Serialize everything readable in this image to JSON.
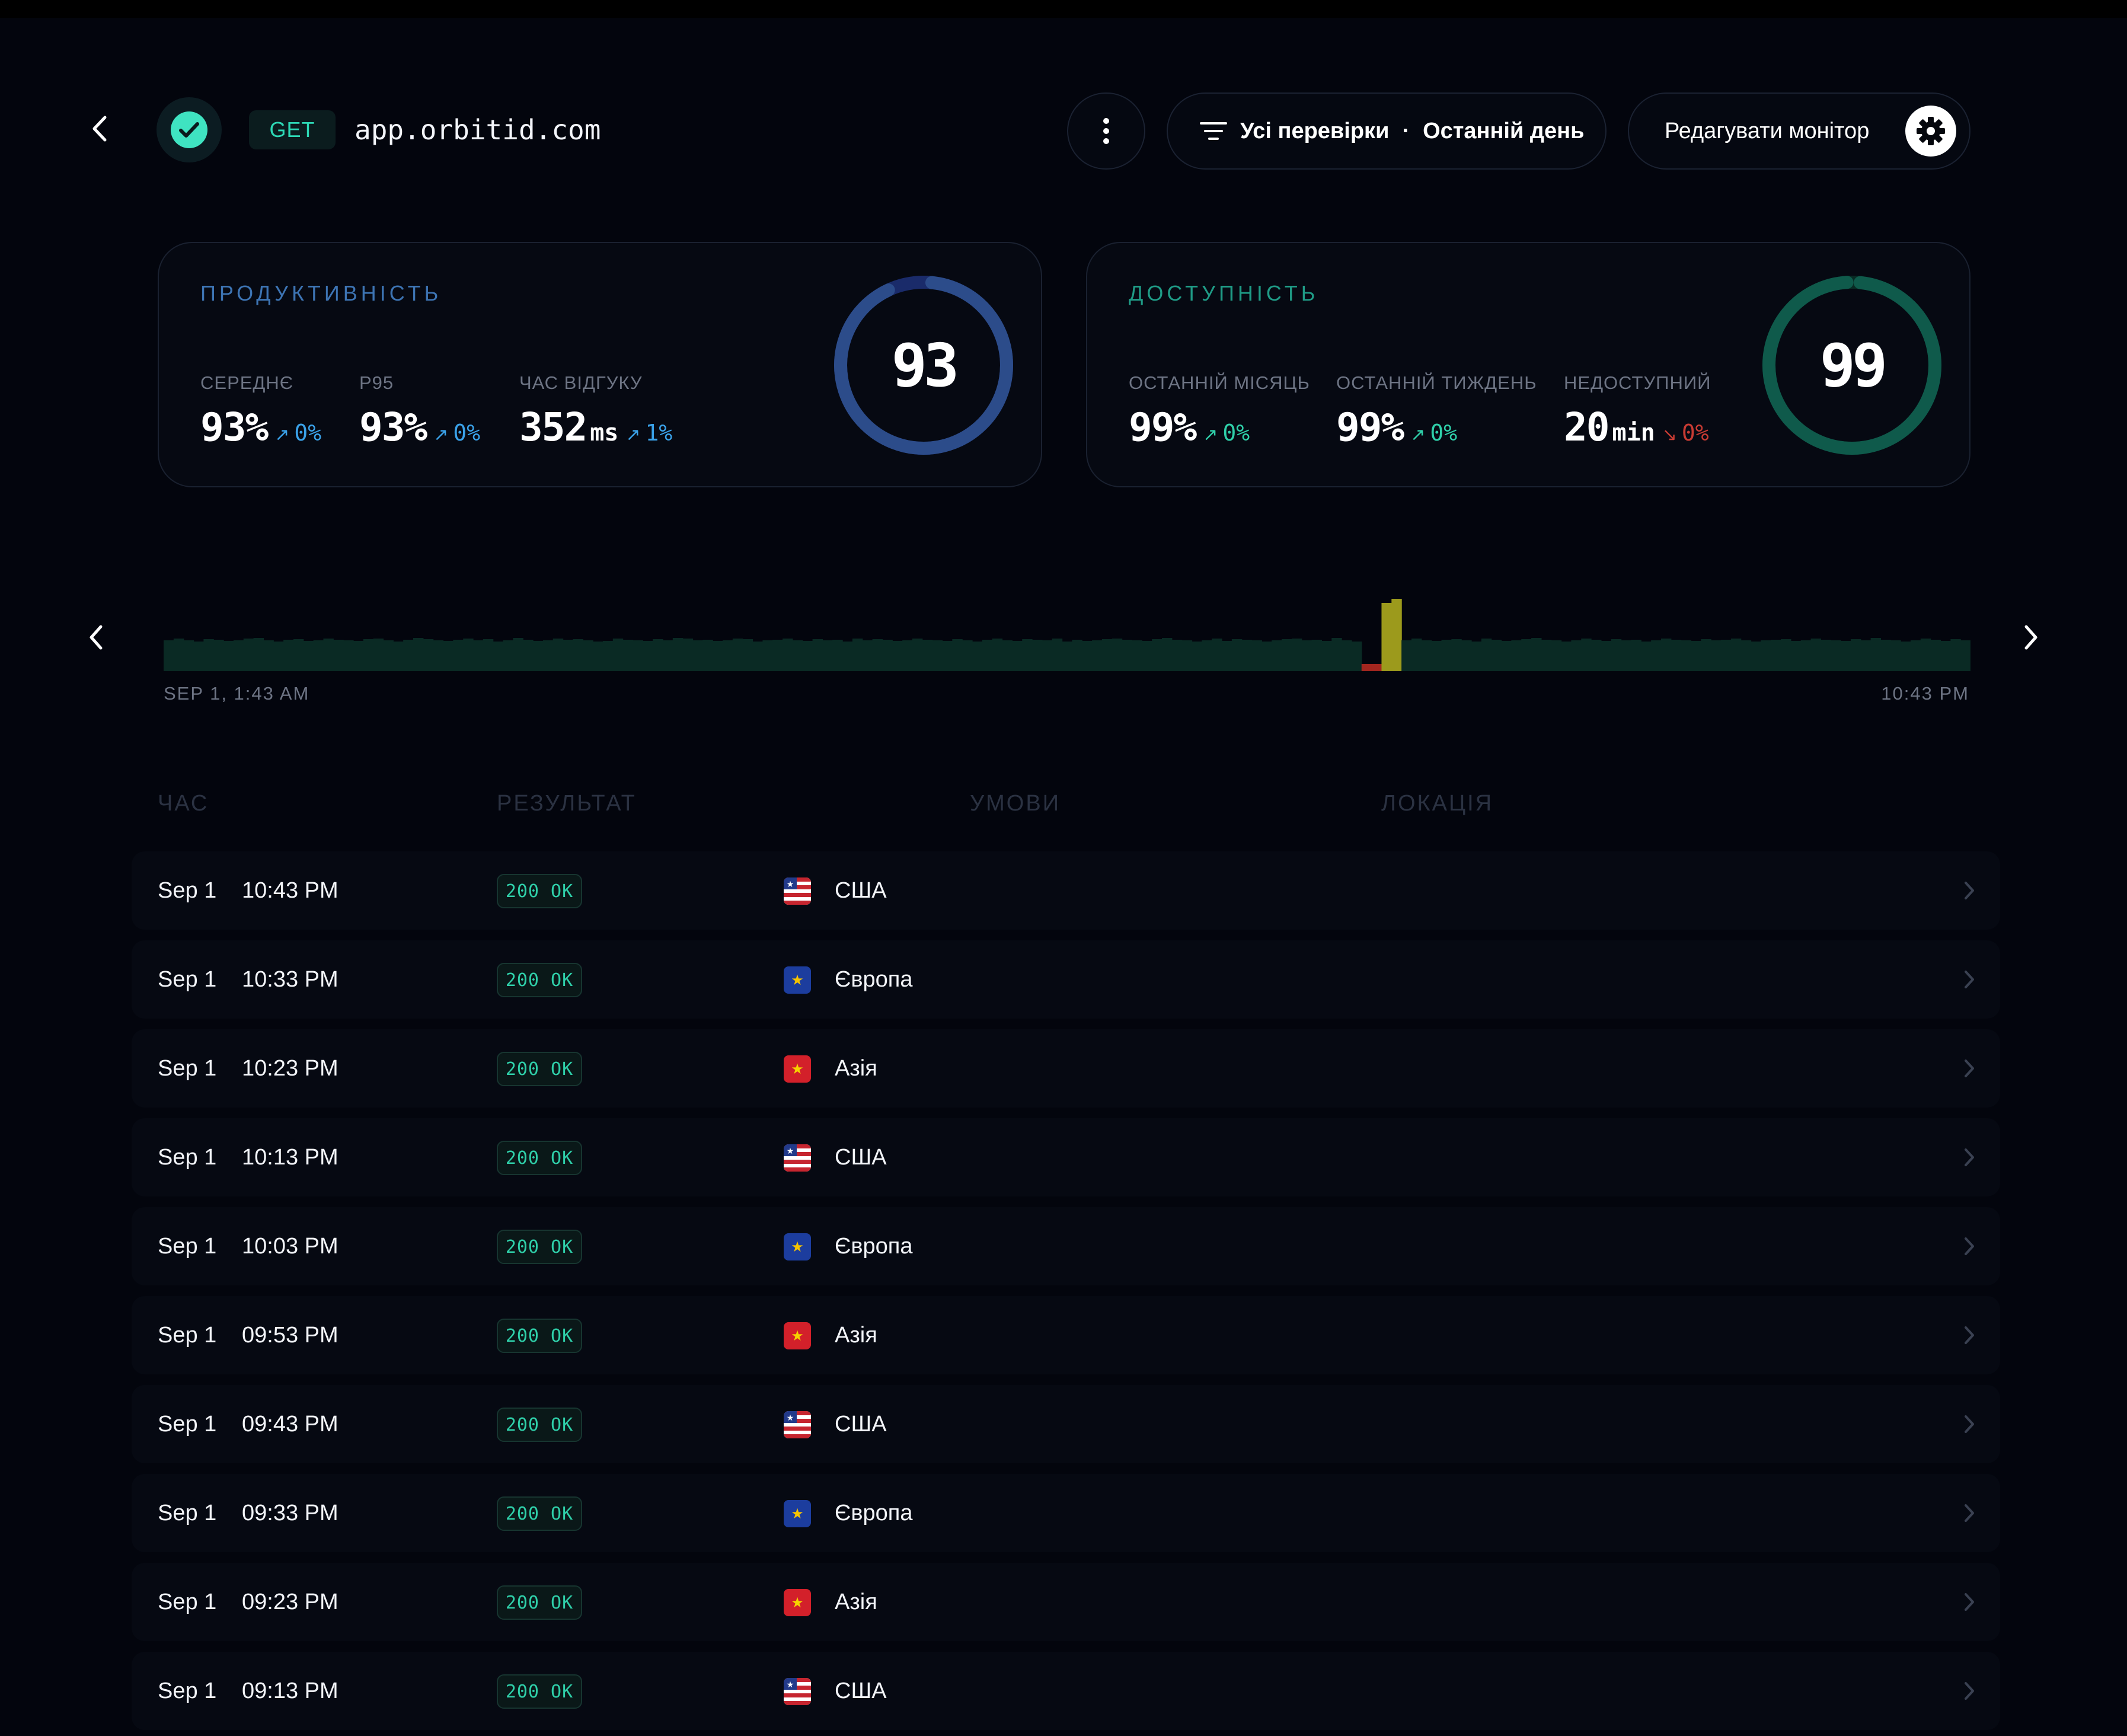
{
  "header": {
    "method": "GET",
    "host": "app.orbitid.com",
    "filter_checks": "Усі перевірки",
    "filter_separator": "·",
    "filter_period": "Останній день",
    "edit_label": "Редагувати монітор"
  },
  "performance": {
    "title": "ПРОДУКТИВНІСТЬ",
    "score": "93",
    "score_fraction": 0.93,
    "ring_color": "#2c4c8a",
    "metrics": [
      {
        "label": "Середнє",
        "value": "93%",
        "unit": "",
        "delta": "0%",
        "trend": "up"
      },
      {
        "label": "P95",
        "value": "93%",
        "unit": "",
        "delta": "0%",
        "trend": "up"
      },
      {
        "label": "Час відгуку",
        "value": "352",
        "unit": "ms",
        "delta": "1%",
        "trend": "up"
      }
    ]
  },
  "availability": {
    "title": "ДОСТУПНІСТЬ",
    "score": "99",
    "score_fraction": 0.99,
    "ring_color": "#0f5a4b",
    "metrics": [
      {
        "label": "Останній місяць",
        "value": "99%",
        "unit": "",
        "delta": "0%",
        "trend": "up"
      },
      {
        "label": "Останній тиждень",
        "value": "99%",
        "unit": "",
        "delta": "0%",
        "trend": "up"
      },
      {
        "label": "Недоступний",
        "value": "20",
        "unit": "min",
        "delta": "0%",
        "trend": "down"
      }
    ]
  },
  "timeline": {
    "start_label": "SEP 1, 1:43 AM",
    "end_label": "10:43 PM",
    "colors": {
      "ok": "#0a2a24",
      "degraded": "#9c9a1c",
      "down": "#a3261f"
    },
    "bars": [
      52,
      55,
      52,
      50,
      54,
      53,
      51,
      52,
      55,
      56,
      52,
      50,
      53,
      54,
      51,
      52,
      55,
      53,
      52,
      51,
      54,
      55,
      52,
      50,
      53,
      56,
      54,
      52,
      51,
      53,
      55,
      52,
      54,
      50,
      52,
      56,
      53,
      51,
      52,
      55,
      53,
      54,
      52,
      50,
      51,
      55,
      53,
      52,
      51,
      54,
      52,
      56,
      55,
      52,
      53,
      51,
      52,
      55,
      54,
      50,
      52,
      53,
      55,
      52,
      51,
      54,
      52,
      53,
      50,
      55,
      52,
      54,
      53,
      51,
      52,
      55,
      53,
      52,
      51,
      54,
      52,
      50,
      53,
      55,
      52,
      51,
      54,
      53,
      52,
      55,
      50,
      53,
      51,
      52,
      54,
      55,
      53,
      52,
      51,
      54,
      56,
      53,
      52,
      50,
      52,
      55,
      51,
      54,
      53,
      52,
      50,
      52,
      54,
      55,
      52,
      53,
      51,
      56,
      52,
      50,
      12,
      12,
      115,
      122,
      52,
      55,
      52,
      51,
      53,
      54,
      52,
      50,
      55,
      53,
      51,
      52,
      54,
      56,
      53,
      52,
      50,
      52,
      55,
      53,
      51,
      54,
      52,
      53,
      50,
      52,
      55,
      53,
      52,
      51,
      54,
      52,
      53,
      55,
      52,
      50,
      52,
      53,
      54,
      51,
      52,
      55,
      53,
      52,
      51,
      54,
      52,
      56,
      53,
      52,
      50,
      52,
      55,
      53,
      51,
      54,
      52
    ],
    "bar_status": {
      "120": "down",
      "121": "down",
      "122": "degraded",
      "123": "degraded"
    }
  },
  "table": {
    "headers": {
      "time": "ЧАС",
      "result": "РЕЗУЛЬТАТ",
      "conditions": "УМОВИ",
      "location": "ЛОКАЦІЯ"
    },
    "rows": [
      {
        "date": "Sep 1",
        "time": "10:43 PM",
        "result": "200 OK",
        "region": "us",
        "location": "США"
      },
      {
        "date": "Sep 1",
        "time": "10:33 PM",
        "result": "200 OK",
        "region": "eu",
        "location": "Європа"
      },
      {
        "date": "Sep 1",
        "time": "10:23 PM",
        "result": "200 OK",
        "region": "asia",
        "location": "Азія"
      },
      {
        "date": "Sep 1",
        "time": "10:13 PM",
        "result": "200 OK",
        "region": "us",
        "location": "США"
      },
      {
        "date": "Sep 1",
        "time": "10:03 PM",
        "result": "200 OK",
        "region": "eu",
        "location": "Європа"
      },
      {
        "date": "Sep 1",
        "time": "09:53 PM",
        "result": "200 OK",
        "region": "asia",
        "location": "Азія"
      },
      {
        "date": "Sep 1",
        "time": "09:43 PM",
        "result": "200 OK",
        "region": "us",
        "location": "США"
      },
      {
        "date": "Sep 1",
        "time": "09:33 PM",
        "result": "200 OK",
        "region": "eu",
        "location": "Європа"
      },
      {
        "date": "Sep 1",
        "time": "09:23 PM",
        "result": "200 OK",
        "region": "asia",
        "location": "Азія"
      },
      {
        "date": "Sep 1",
        "time": "09:13 PM",
        "result": "200 OK",
        "region": "us",
        "location": "США"
      }
    ]
  }
}
